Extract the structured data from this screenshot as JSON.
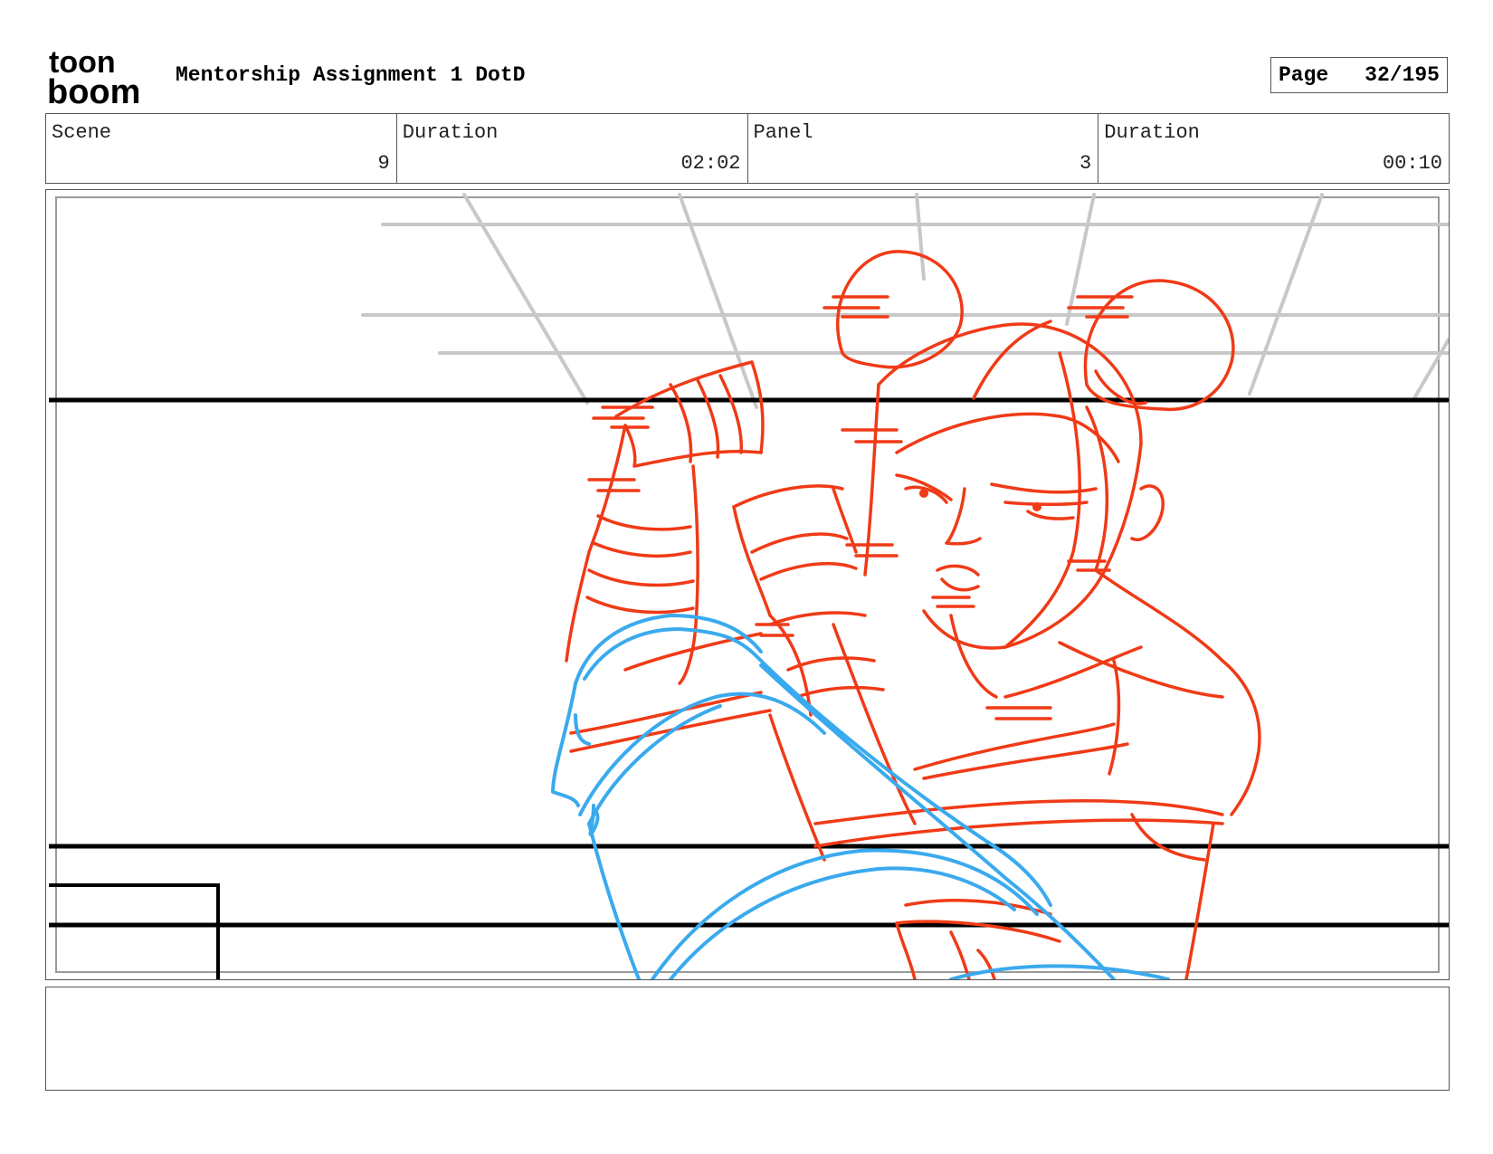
{
  "header": {
    "logo_line1": "toon",
    "logo_line2": "boom",
    "title": "Mentorship Assignment 1 DotD",
    "page_label": "Page",
    "page_number": "32/195"
  },
  "info": [
    {
      "label": "Scene",
      "value": "9"
    },
    {
      "label": "Duration",
      "value": "02:02"
    },
    {
      "label": "Panel",
      "value": "3"
    },
    {
      "label": "Duration",
      "value": "00:10"
    }
  ],
  "panel": {
    "colors": {
      "sketch": "#f03a17",
      "rough": "#3aaaee",
      "background_grid": "#c8c8c8",
      "lines": "#000000"
    },
    "notes": ""
  }
}
